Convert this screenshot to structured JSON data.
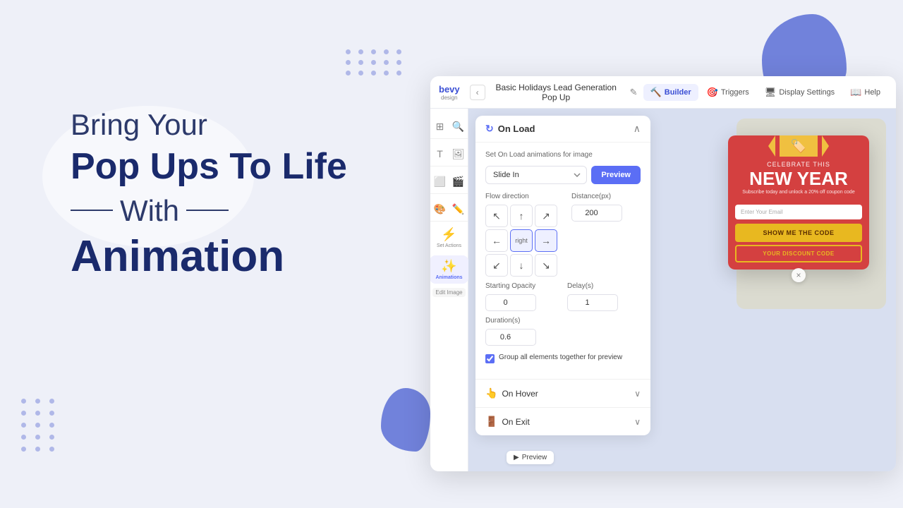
{
  "background": {
    "color": "#eef0f8"
  },
  "left": {
    "line1": "Bring Your",
    "line2": "Pop Ups To Life",
    "line3": "With",
    "line4": "Animation"
  },
  "builder": {
    "title": "Basic Holidays Lead Generation Pop Up",
    "tabs": [
      {
        "label": "Builder",
        "icon": "🔨",
        "active": true
      },
      {
        "label": "Triggers",
        "icon": "🎯"
      },
      {
        "label": "Display Settings",
        "icon": "🖥"
      },
      {
        "label": "Help",
        "icon": "📖"
      }
    ],
    "tools": {
      "rows": [
        [
          "📦",
          "🔍"
        ],
        [
          "T",
          "🖼"
        ],
        [
          "⬜",
          "🎬"
        ],
        [
          "🎨",
          "✏️"
        ]
      ]
    },
    "set_actions_label": "Set Actions",
    "animations_label": "Animations",
    "edit_image_label": "Edit Image"
  },
  "animation_panel": {
    "title": "On Load",
    "description": "Set On Load animations for image",
    "slide_in_label": "Slide In",
    "preview_btn": "Preview",
    "flow_direction_label": "Flow direction",
    "distance_label": "Distance(px)",
    "distance_value": "200",
    "starting_opacity_label": "Starting Opacity",
    "starting_opacity_value": "0",
    "delay_label": "Delay(s)",
    "delay_value": "1",
    "duration_label": "Duration(s)",
    "duration_value": "0.6",
    "group_elements_label": "Group all elements together for preview",
    "group_checked": true,
    "direction_selected": "right",
    "directions": [
      {
        "key": "up-left",
        "icon": "↖"
      },
      {
        "key": "up",
        "icon": "↑"
      },
      {
        "key": "up-right",
        "icon": "↗"
      },
      {
        "key": "left",
        "icon": "←"
      },
      {
        "key": "right-label",
        "text": "right"
      },
      {
        "key": "right-arrow",
        "icon": "→"
      },
      {
        "key": "down-left",
        "icon": "↙"
      },
      {
        "key": "down",
        "icon": "↓"
      },
      {
        "key": "down-right",
        "icon": "↘"
      }
    ],
    "on_hover_label": "On Hover",
    "on_exit_label": "On Exit"
  },
  "popup": {
    "celebrate_text": "CELEBRATE THIS",
    "new_year_text": "NEW YEAR",
    "subscribe_text": "Subscribe today and unlock a 20% off coupon code",
    "email_placeholder": "Enter Your Email",
    "show_code_btn": "SHOW ME THE CODE",
    "discount_btn": "YOUR DISCOUNT CODE"
  },
  "preview_btn": "Preview",
  "icons": {
    "refresh": "↻",
    "chevron_up": "∧",
    "chevron_down": "∨",
    "close": "×",
    "back": "‹",
    "pencil": "✎"
  }
}
